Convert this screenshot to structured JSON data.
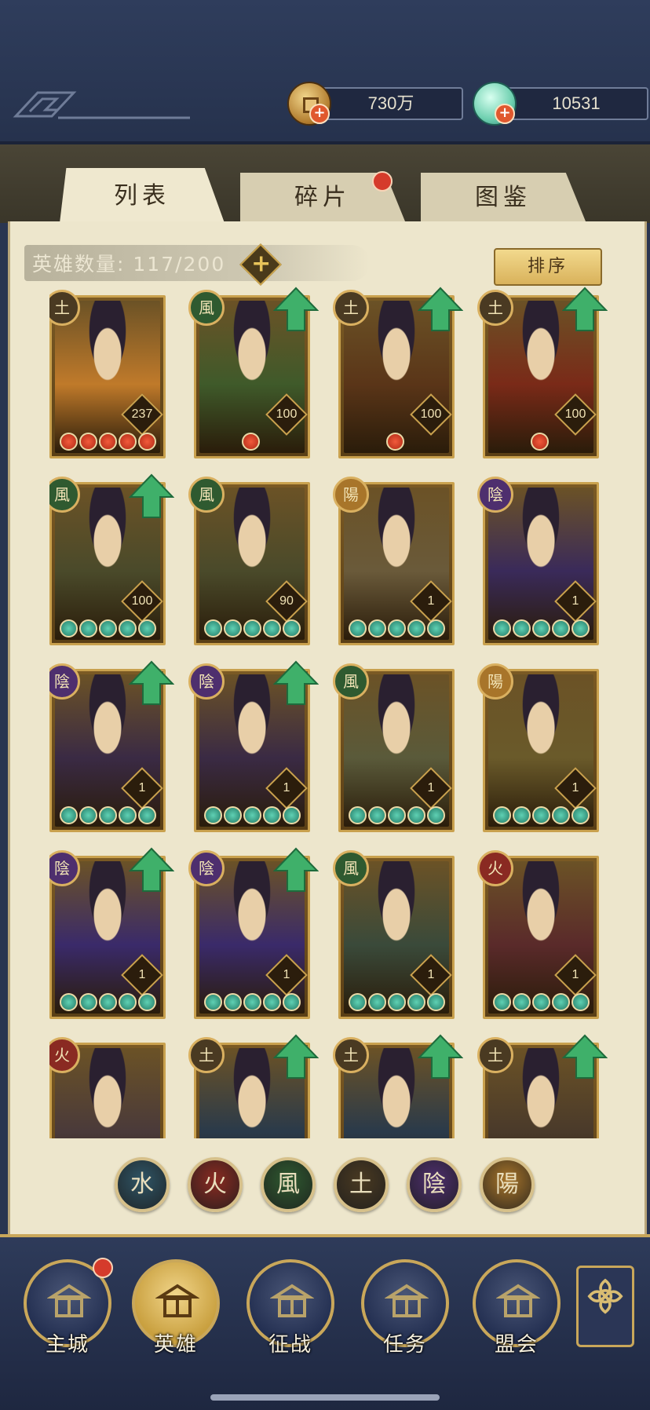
{
  "currencies": [
    {
      "name": "coin-currency",
      "value": "730万",
      "icon": "coin-icon"
    },
    {
      "name": "gem-currency",
      "value": "10531",
      "icon": "gem-icon"
    }
  ],
  "tabs": [
    {
      "label": "列表",
      "active": true
    },
    {
      "label": "碎片",
      "active": false,
      "badge": true
    },
    {
      "label": "图鉴",
      "active": false
    }
  ],
  "hero_count": {
    "label": "英雄数量:",
    "value": "117/200"
  },
  "sort_label": "排序",
  "heroes": [
    {
      "element": "土",
      "level": "237",
      "stars": "red",
      "upgrade": false,
      "palette": "#c07a2a"
    },
    {
      "element": "風",
      "level": "100",
      "stars": "red1",
      "upgrade": true,
      "palette": "#3f5a2a"
    },
    {
      "element": "土",
      "level": "100",
      "stars": "red1",
      "upgrade": true,
      "palette": "#5a3518"
    },
    {
      "element": "土",
      "level": "100",
      "stars": "red1",
      "upgrade": true,
      "palette": "#7a2a18"
    },
    {
      "element": "風",
      "level": "100",
      "stars": "teal",
      "upgrade": true,
      "palette": "#4a4a2a"
    },
    {
      "element": "風",
      "level": "90",
      "stars": "teal",
      "upgrade": false,
      "palette": "#4a4a2a"
    },
    {
      "element": "陽",
      "level": "1",
      "stars": "teal",
      "upgrade": false,
      "palette": "#6a5a3a"
    },
    {
      "element": "陰",
      "level": "1",
      "stars": "teal",
      "upgrade": false,
      "palette": "#3a2a5a"
    },
    {
      "element": "陰",
      "level": "1",
      "stars": "teal",
      "upgrade": true,
      "palette": "#3a2a44"
    },
    {
      "element": "陰",
      "level": "1",
      "stars": "teal",
      "upgrade": true,
      "palette": "#3a2a44"
    },
    {
      "element": "風",
      "level": "1",
      "stars": "teal",
      "upgrade": false,
      "palette": "#5a5a3a"
    },
    {
      "element": "陽",
      "level": "1",
      "stars": "teal",
      "upgrade": false,
      "palette": "#6a5a2a"
    },
    {
      "element": "陰",
      "level": "1",
      "stars": "teal",
      "upgrade": true,
      "palette": "#3a2a6a"
    },
    {
      "element": "陰",
      "level": "1",
      "stars": "teal",
      "upgrade": true,
      "palette": "#3a2a6a"
    },
    {
      "element": "風",
      "level": "1",
      "stars": "teal",
      "upgrade": false,
      "palette": "#3a4a3a"
    },
    {
      "element": "火",
      "level": "1",
      "stars": "teal",
      "upgrade": false,
      "palette": "#5a2a2a"
    },
    {
      "element": "火",
      "level": "",
      "stars": "none",
      "upgrade": false,
      "palette": "#4a3a3a"
    },
    {
      "element": "土",
      "level": "",
      "stars": "none",
      "upgrade": true,
      "palette": "#2a3a4a"
    },
    {
      "element": "土",
      "level": "",
      "stars": "none",
      "upgrade": true,
      "palette": "#2a3a4a"
    },
    {
      "element": "土",
      "level": "",
      "stars": "none",
      "upgrade": true,
      "palette": "#4a3a2a"
    }
  ],
  "element_colors": {
    "土": "#4a3a22",
    "風": "#2f5a30",
    "陽": "#a8752a",
    "陰": "#4e2f6e",
    "火": "#8a2a22",
    "水": "#2a5a6a"
  },
  "filters": [
    {
      "glyph": "水",
      "color": "#2f5566",
      "name": "filter-water"
    },
    {
      "glyph": "火",
      "color": "#8a2b22",
      "name": "filter-fire"
    },
    {
      "glyph": "風",
      "color": "#2f5a30",
      "name": "filter-wind"
    },
    {
      "glyph": "土",
      "color": "#4a3a22",
      "name": "filter-earth"
    },
    {
      "glyph": "陰",
      "color": "#4e2f6e",
      "name": "filter-yin"
    },
    {
      "glyph": "陽",
      "color": "#a8752a",
      "name": "filter-yang"
    }
  ],
  "nav": [
    {
      "label": "主城",
      "name": "nav-main-city",
      "badge": true,
      "active": false
    },
    {
      "label": "英雄",
      "name": "nav-heroes",
      "badge": false,
      "active": true
    },
    {
      "label": "征战",
      "name": "nav-campaign",
      "badge": false,
      "active": false
    },
    {
      "label": "任务",
      "name": "nav-quests",
      "badge": false,
      "active": false
    },
    {
      "label": "盟会",
      "name": "nav-alliance",
      "badge": false,
      "active": false
    }
  ]
}
